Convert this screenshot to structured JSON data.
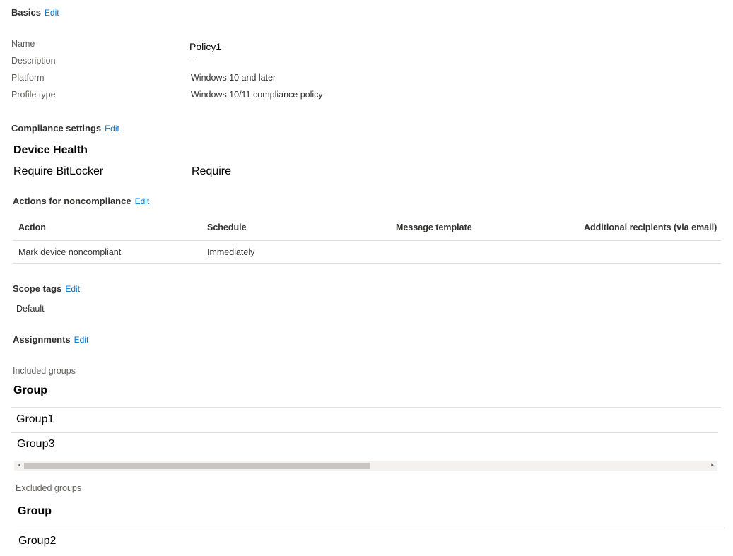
{
  "basics": {
    "title": "Basics",
    "edit": "Edit",
    "fields": [
      {
        "label": "Name",
        "value": "Policy1"
      },
      {
        "label": "Description",
        "value": "--"
      },
      {
        "label": "Platform",
        "value": "Windows 10 and later"
      },
      {
        "label": "Profile type",
        "value": "Windows 10/11 compliance policy"
      }
    ]
  },
  "compliance": {
    "title": "Compliance settings",
    "edit": "Edit",
    "group_title": "Device Health",
    "setting_label": "Require BitLocker",
    "setting_value": "Require"
  },
  "actions": {
    "title": "Actions for noncompliance",
    "edit": "Edit",
    "columns": [
      "Action",
      "Schedule",
      "Message template",
      "Additional recipients (via email)"
    ],
    "rows": [
      [
        "Mark device noncompliant",
        "Immediately",
        "",
        ""
      ]
    ]
  },
  "scope_tags": {
    "title": "Scope tags",
    "edit": "Edit",
    "value": "Default"
  },
  "assignments": {
    "title": "Assignments",
    "edit": "Edit",
    "included": {
      "label": "Included groups",
      "column": "Group",
      "groups": [
        "Group1",
        "Group3"
      ]
    },
    "excluded": {
      "label": "Excluded groups",
      "column": "Group",
      "groups": [
        "Group2"
      ]
    }
  },
  "colors": {
    "link": "#0078d4",
    "text": "#323130",
    "secondary_text": "#605e5c",
    "divider": "#e1dfdd"
  }
}
